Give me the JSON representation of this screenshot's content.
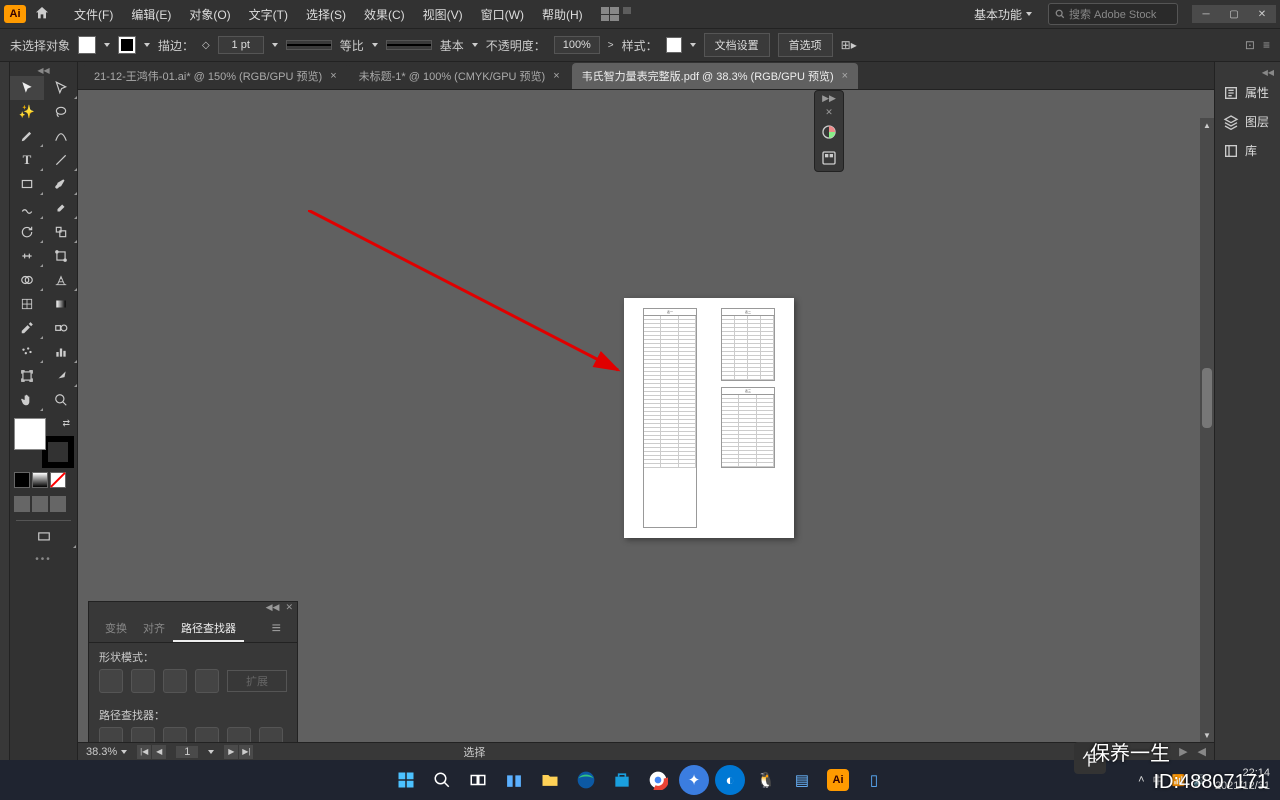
{
  "titlebar": {
    "logo_text": "Ai",
    "workspace": "基本功能",
    "search_placeholder": "搜索 Adobe Stock"
  },
  "menu": {
    "file": "文件(F)",
    "edit": "编辑(E)",
    "object": "对象(O)",
    "type": "文字(T)",
    "select": "选择(S)",
    "effect": "效果(C)",
    "view": "视图(V)",
    "window": "窗口(W)",
    "help": "帮助(H)"
  },
  "options": {
    "selection_label": "未选择对象",
    "stroke_label": "描边：",
    "stroke_value": "1 pt",
    "uniform": "等比",
    "basic": "基本",
    "opacity_label": "不透明度：",
    "opacity_value": "100%",
    "style_label": "样式：",
    "doc_setup": "文档设置",
    "prefs": "首选项"
  },
  "tabs": {
    "t1": "21-12-王鸿伟-01.ai* @ 150% (RGB/GPU 预览)",
    "t2": "未标题-1* @ 100% (CMYK/GPU 预览)",
    "t3": "韦氏智力量表完整版.pdf @ 38.3% (RGB/GPU 预览)"
  },
  "right_panels": {
    "properties": "属性",
    "layers": "图层",
    "libraries": "库"
  },
  "pathfinder": {
    "tab_transform": "变换",
    "tab_align": "对齐",
    "tab_pathfinder": "路径查找器",
    "shape_modes": "形状模式：",
    "expand": "扩展",
    "pathfinders": "路径查找器："
  },
  "status": {
    "zoom": "38.3%",
    "page": "1",
    "tool": "选择"
  },
  "system": {
    "ime": "中",
    "time": "22:14",
    "date": "2021/12/31"
  },
  "watermark": {
    "brand": "保养一生",
    "id": "ID:48807171"
  }
}
